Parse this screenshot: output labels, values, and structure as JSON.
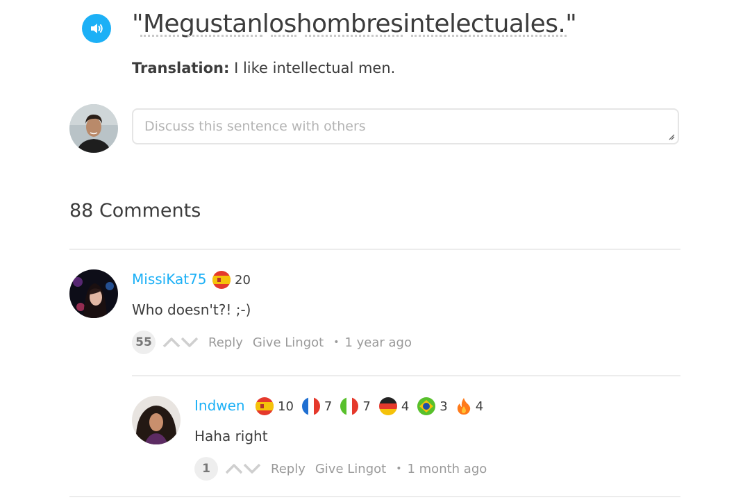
{
  "sentence": {
    "words": [
      "\"Me",
      " gustan",
      " los",
      " hombres",
      " intelectuales.\""
    ],
    "translation_label": "Translation:",
    "translation_text": "I like intellectual men."
  },
  "discussion": {
    "placeholder": "Discuss this sentence with others"
  },
  "comments_title": "88 Comments",
  "comments": [
    {
      "username": "MissiKat75",
      "flags": [
        {
          "country": "es",
          "level": "20"
        }
      ],
      "text": "Who doesn't?! ;-)",
      "votes": "55",
      "reply_label": "Reply",
      "lingot_label": "Give Lingot",
      "time": "1 year ago"
    },
    {
      "username": "Indwen",
      "flags": [
        {
          "country": "es",
          "level": "10"
        },
        {
          "country": "fr",
          "level": "7"
        },
        {
          "country": "it",
          "level": "7"
        },
        {
          "country": "de",
          "level": "4"
        },
        {
          "country": "br",
          "level": "3"
        },
        {
          "country": "streak",
          "level": "4"
        }
      ],
      "text": "Haha right",
      "votes": "1",
      "reply_label": "Reply",
      "lingot_label": "Give Lingot",
      "time": "1 month ago"
    }
  ],
  "colors": {
    "accent": "#1cb0f6",
    "text": "#3c3c3c",
    "muted": "#9a9a9a",
    "divider": "#ececec"
  },
  "icons": {
    "speaker": "speaker-icon",
    "upvote": "chevron-up-icon",
    "downvote": "chevron-down-icon",
    "streak": "flame-icon"
  }
}
